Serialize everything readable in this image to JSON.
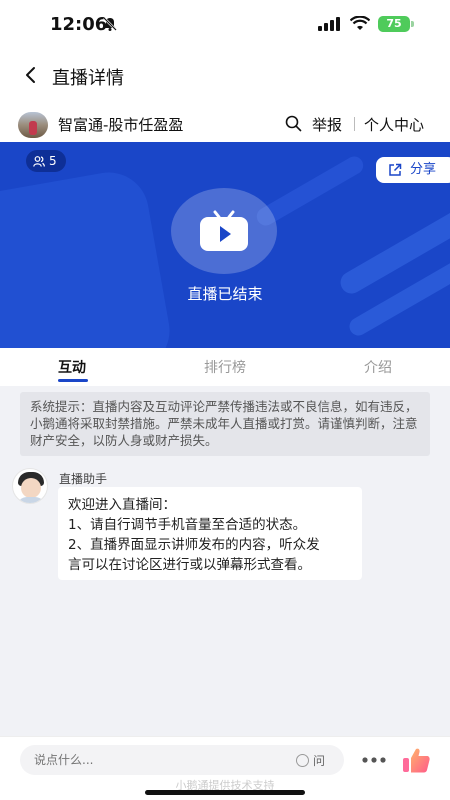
{
  "status_bar": {
    "time": "12:06",
    "battery": "75"
  },
  "nav": {
    "title": "直播详情"
  },
  "channel": {
    "name": "智富通-股市任盈盈",
    "report": "举报",
    "personal_center": "个人中心"
  },
  "video": {
    "viewers": "5",
    "share": "分享",
    "status": "直播已结束",
    "bg_color": "#1a46c8"
  },
  "tabs": [
    {
      "label": "互动",
      "active": true
    },
    {
      "label": "排行榜",
      "active": false
    },
    {
      "label": "介绍",
      "active": false
    }
  ],
  "chat": {
    "system_notice": "系统提示：直播内容及互动评论严禁传播违法或不良信息，如有违反，小鹅通将采取封禁措施。严禁未成年人直播或打赏。请谨慎判断，注意财产安全，以防人身或财产损失。",
    "messages": [
      {
        "sender": "直播助手",
        "lines": [
          "欢迎进入直播间：",
          "1、请自行调节手机音量至合适的状态。",
          "2、直播界面显示讲师发布的内容，听众发",
          "言可以在讨论区进行或以弹幕形式查看。"
        ]
      }
    ]
  },
  "bottom": {
    "input_placeholder": "说点什么...",
    "ask_label": "问",
    "footer_credit": "小鹅通提供技术支持"
  }
}
